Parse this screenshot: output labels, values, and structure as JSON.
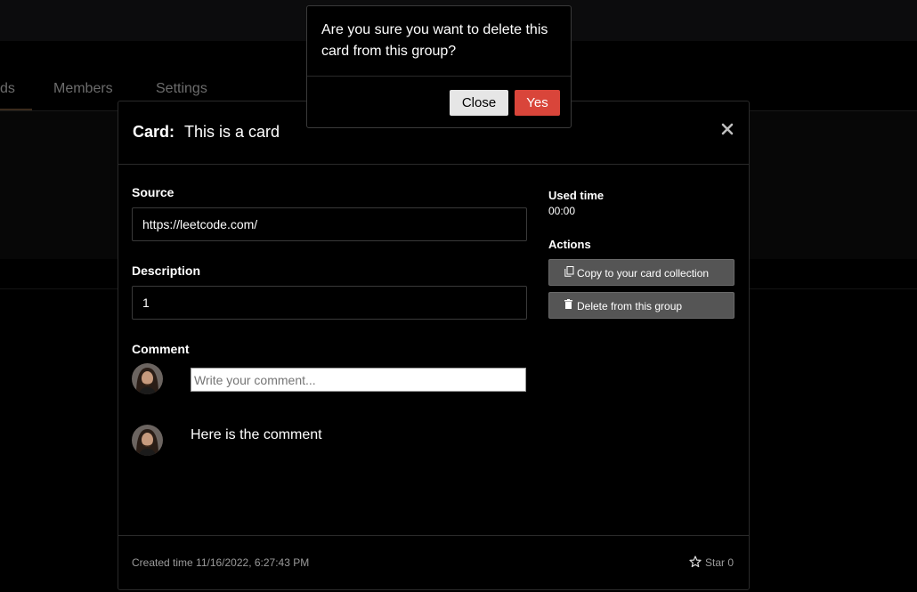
{
  "tabs": {
    "cards": "ds",
    "members": "Members",
    "settings": "Settings"
  },
  "modal": {
    "card_label": "Card:",
    "card_title": "This is a card",
    "source_label": "Source",
    "source_value": "https://leetcode.com/",
    "description_label": "Description",
    "description_value": "1",
    "comment_label": "Comment",
    "comment_placeholder": "Write your comment...",
    "comments": [
      "Here is the comment"
    ],
    "used_time_label": "Used time",
    "used_time_value": "00:00",
    "actions_label": "Actions",
    "copy_button": "Copy to your card collection",
    "delete_button": "Delete from this group",
    "created": "Created time 11/16/2022, 6:27:43 PM",
    "star": "Star 0"
  },
  "confirm": {
    "message": "Are you sure you want to delete this card from this group?",
    "close_button": "Close",
    "yes_button": "Yes"
  },
  "icons": [
    "close-icon",
    "copy-icon",
    "trash-icon",
    "star-icon",
    "avatar"
  ]
}
